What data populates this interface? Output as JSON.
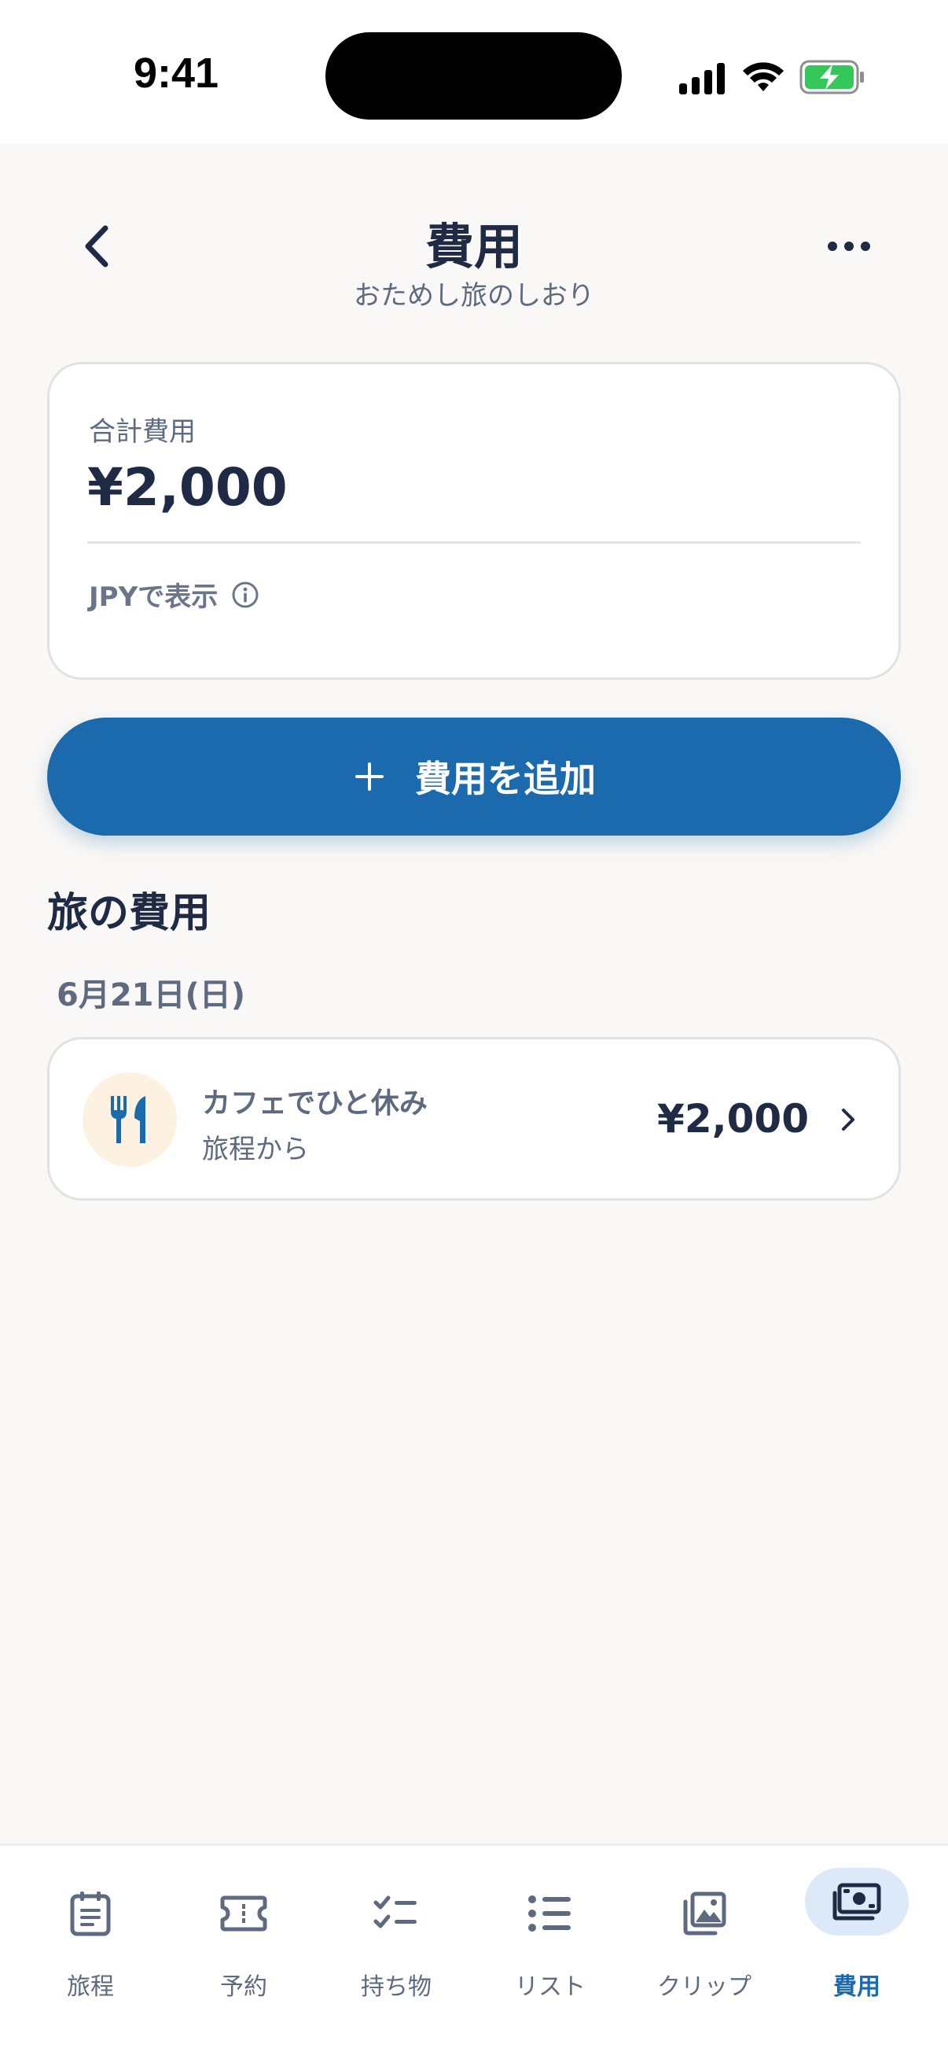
{
  "status_bar": {
    "time": "9:41"
  },
  "header": {
    "title": "費用",
    "subtitle": "おためし旅のしおり"
  },
  "summary": {
    "label": "合計費用",
    "amount": "¥2,000",
    "currency_note": "JPYで表示"
  },
  "add_button": {
    "label": "費用を追加"
  },
  "section": {
    "title": "旅の費用"
  },
  "groups": [
    {
      "date": "6月21日(日)",
      "items": [
        {
          "name": "カフェでひと休み",
          "source": "旅程から",
          "amount": "¥2,000",
          "category_icon": "fork-knife-icon"
        }
      ]
    }
  ],
  "tabs": [
    {
      "label": "旅程",
      "icon": "itinerary-icon"
    },
    {
      "label": "予約",
      "icon": "ticket-icon"
    },
    {
      "label": "持ち物",
      "icon": "checklist-icon"
    },
    {
      "label": "リスト",
      "icon": "list-icon"
    },
    {
      "label": "クリップ",
      "icon": "photo-icon"
    },
    {
      "label": "費用",
      "icon": "money-icon",
      "active": true
    }
  ],
  "colors": {
    "accent": "#1a6aad",
    "text_dark": "#1f2a44",
    "text_muted": "#5e6a80",
    "background": "#f9f8f6",
    "category_bg": "#fdf1e1",
    "active_tab_bg": "#dbe9f8"
  }
}
